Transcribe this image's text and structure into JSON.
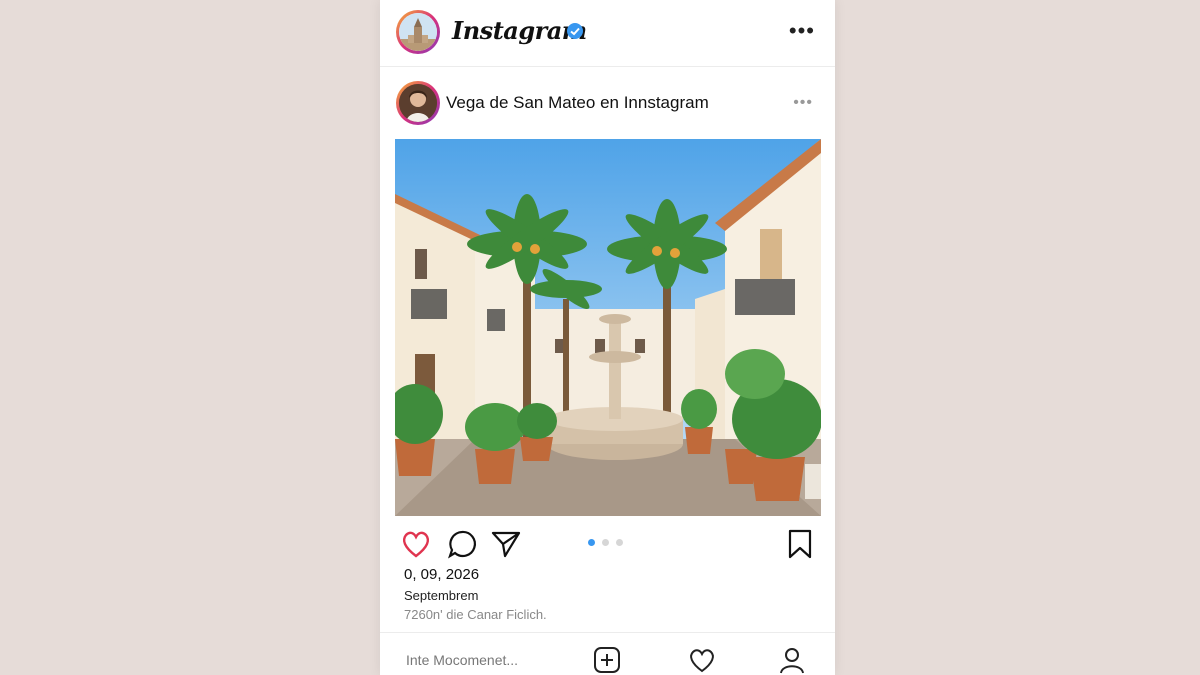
{
  "header": {
    "app_title": "Instagram",
    "verified_icon": "verified-badge-icon",
    "more_icon": "more-horizontal-icon"
  },
  "post": {
    "username": "Vega de San Mateo en Innstagram",
    "more_icon": "more-horizontal-icon",
    "image_alt": "plaza with fountain, palm trees and white buildings"
  },
  "actions": {
    "like_icon": "heart-icon",
    "comment_icon": "comment-icon",
    "share_icon": "send-icon",
    "save_icon": "bookmark-icon",
    "carousel_count": 3,
    "carousel_active": 0
  },
  "caption": {
    "date": "0, 09, 2026",
    "month": "Septembrem",
    "meta": "7260n' die  Canar Ficlich."
  },
  "bottom_bar": {
    "comment_placeholder": "Inte Mocomenet...",
    "add_icon": "add-square-icon",
    "activity_icon": "heart-icon",
    "profile_icon": "user-icon"
  },
  "colors": {
    "background": "#e6dcd8",
    "accent_blue": "#3897f0",
    "like_red": "#e0344f"
  }
}
